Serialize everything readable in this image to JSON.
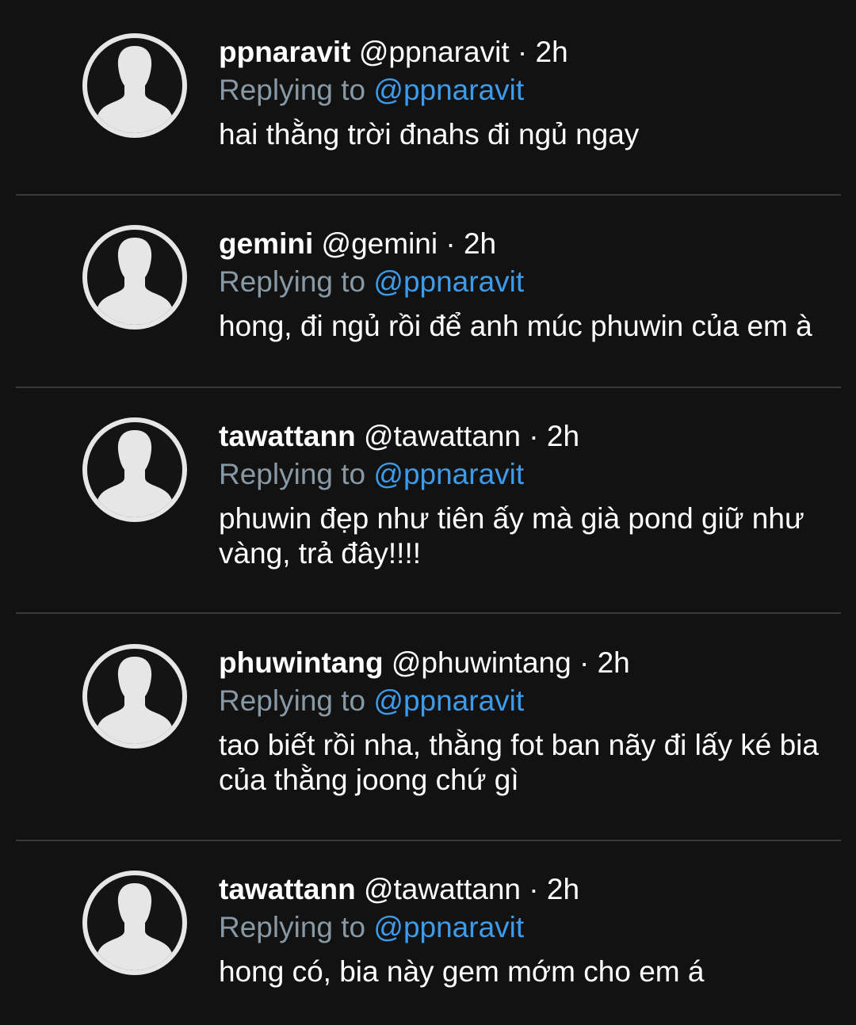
{
  "tweets": [
    {
      "name": "ppnaravit",
      "handle": "@ppnaravit",
      "time": "2h",
      "replying_label": "Replying to",
      "replying_to": "@ppnaravit",
      "text": "hai thằng trời đnahs đi ngủ ngay"
    },
    {
      "name": "gemini",
      "handle": "@gemini",
      "time": "2h",
      "replying_label": "Replying to",
      "replying_to": "@ppnaravit",
      "text": "hong, đi ngủ rồi để anh múc phuwin của em à"
    },
    {
      "name": "tawattann",
      "handle": "@tawattann",
      "time": "2h",
      "replying_label": "Replying to",
      "replying_to": "@ppnaravit",
      "text": "phuwin đẹp như tiên ấy mà già pond giữ như vàng, trả đây!!!!"
    },
    {
      "name": "phuwintang",
      "handle": "@phuwintang",
      "time": "2h",
      "replying_label": "Replying to",
      "replying_to": "@ppnaravit",
      "text": "tao biết rồi nha, thằng fot ban nãy đi lấy ké bia của thằng joong chứ gì"
    },
    {
      "name": "tawattann",
      "handle": "@tawattann",
      "time": "2h",
      "replying_label": "Replying to",
      "replying_to": "@ppnaravit",
      "text": "hong có, bia này gem mớm cho em á"
    }
  ],
  "separator": "·",
  "colors": {
    "background": "#121212",
    "text": "#ffffff",
    "muted": "#8899a6",
    "link": "#3d9bea",
    "divider": "#3a3a3a",
    "avatar": "#e6e6e6"
  },
  "icons": {
    "avatar": "default-profile-silhouette-icon"
  }
}
